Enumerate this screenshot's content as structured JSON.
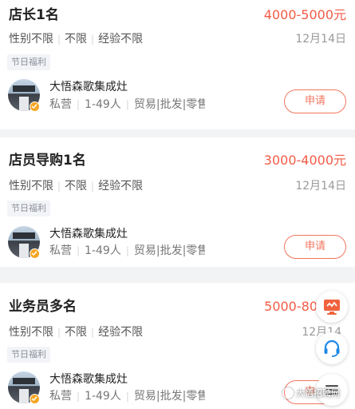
{
  "jobs": [
    {
      "title": "店长1名",
      "salary": "4000-5000元",
      "requirements": [
        "性别不限",
        "不限",
        "经验不限"
      ],
      "date": "12月14日",
      "tag": "节日福利",
      "company": "大悟森歌集成灶",
      "company_info": [
        "私营",
        "1-49人",
        "贸易|批发|零售"
      ],
      "apply_label": "申请"
    },
    {
      "title": "店员导购1名",
      "salary": "3000-4000元",
      "requirements": [
        "性别不限",
        "不限",
        "经验不限"
      ],
      "date": "12月14日",
      "tag": "节日福利",
      "company": "大悟森歌集成灶",
      "company_info": [
        "私营",
        "1-49人",
        "贸易|批发|零售"
      ],
      "apply_label": "申请"
    },
    {
      "title": "业务员多名",
      "salary": "5000-80",
      "requirements": [
        "性别不限",
        "不限",
        "经验不限"
      ],
      "date": "12月14",
      "tag": "节日福利",
      "company": "大悟森歌集成灶",
      "company_info": [
        "私营",
        "1-49人",
        "贸易|批发|零售"
      ],
      "apply_label": "申请"
    }
  ],
  "floating_buttons": [
    "monitor-icon",
    "customer-service-icon",
    "menu-icon"
  ],
  "watermark": {
    "text": "大悟招聘网"
  },
  "colors": {
    "accent": "#f25b46",
    "button": "#f2765f",
    "verified": "#f5a623",
    "background": "#f2f3f5"
  }
}
